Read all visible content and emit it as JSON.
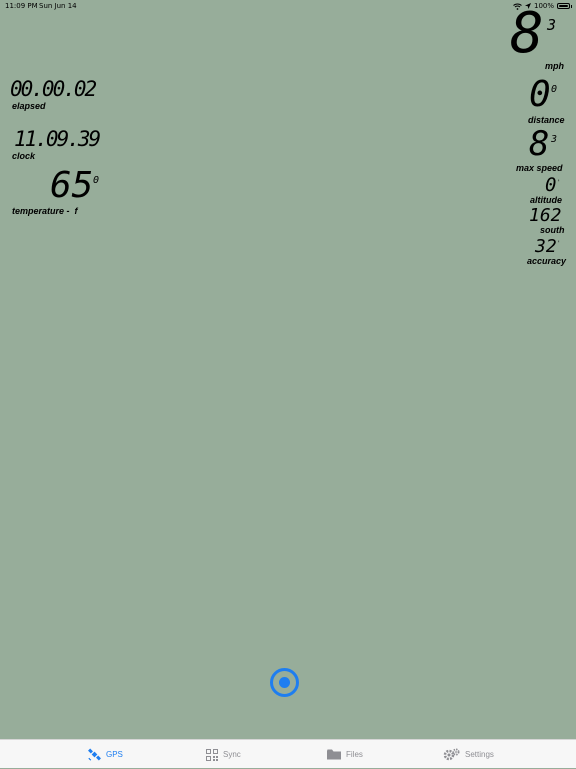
{
  "status": {
    "time": "11:09 PM",
    "date": "Sun Jun 14",
    "battery": "100%"
  },
  "speed": {
    "value": "8",
    "tenths": "3",
    "unit": "mph"
  },
  "distance": {
    "value": "0",
    "tenths": "0",
    "label": "distance"
  },
  "max_speed": {
    "value": "8",
    "tenths": "3",
    "label": "max speed"
  },
  "altitude": {
    "value": "0",
    "label": "altitude"
  },
  "heading": {
    "value": "162",
    "label": "south"
  },
  "accuracy": {
    "value": "32",
    "label": "accuracy"
  },
  "elapsed": {
    "value": "00.00.02",
    "label": "elapsed"
  },
  "clock": {
    "value": "11.09.39",
    "label": "clock"
  },
  "temperature": {
    "value": "65",
    "tenths": "0",
    "label": "temperature -  f"
  },
  "tabs": [
    {
      "label": "GPS",
      "icon": "satellite-icon",
      "active": true
    },
    {
      "label": "Sync",
      "icon": "qr-code-icon",
      "active": false
    },
    {
      "label": "Files",
      "icon": "folder-icon",
      "active": false
    },
    {
      "label": "Settings",
      "icon": "gear-icon",
      "active": false
    }
  ],
  "colors": {
    "background": "#97ad9a",
    "accent": "#1e7ef0",
    "tab_inactive": "#8e8e93"
  }
}
